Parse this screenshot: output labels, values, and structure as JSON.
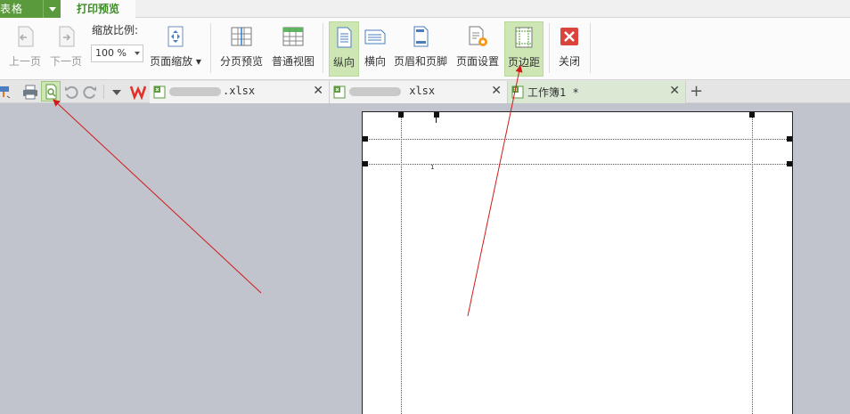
{
  "tabs": {
    "app_menu_label": "表格",
    "print_preview_tab": "打印预览"
  },
  "ribbon": {
    "prev_page": "上一页",
    "next_page": "下一页",
    "zoom_label": "缩放比例:",
    "zoom_value": "100 %",
    "page_zoom": "页面缩放",
    "page_break_preview": "分页预览",
    "normal_view": "普通视图",
    "portrait": "纵向",
    "landscape": "横向",
    "header_footer": "页眉和页脚",
    "page_setup": "页面设置",
    "page_margins": "页边距",
    "close": "关闭"
  },
  "file_tabs": [
    {
      "name": ".xlsx",
      "active": false
    },
    {
      "name": " xlsx",
      "active": false
    },
    {
      "name": "工作簿1 *",
      "active": true
    }
  ],
  "preview": {
    "page_number": "1"
  },
  "colors": {
    "accent_green": "#5a9a3c",
    "active_button": "#cde6b4",
    "annotation_arrow": "#d11a1a",
    "close_red": "#d9443c"
  }
}
